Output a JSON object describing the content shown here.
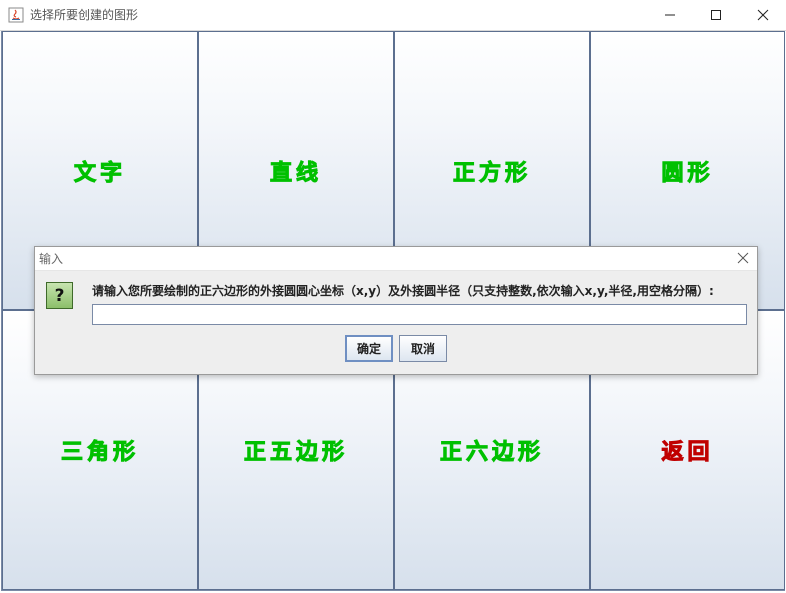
{
  "window": {
    "title": "选择所要创建的图形",
    "icons": [
      "java-app-icon",
      "minimize-icon",
      "maximize-icon",
      "close-icon"
    ]
  },
  "buttons": [
    {
      "label": "文字",
      "color": "#00ff00"
    },
    {
      "label": "直线",
      "color": "#00ff00"
    },
    {
      "label": "正方形",
      "color": "#00ff00"
    },
    {
      "label": "圆形",
      "color": "#00ff00"
    },
    {
      "label": "三角形",
      "color": "#00ff00"
    },
    {
      "label": "正五边形",
      "color": "#00ff00"
    },
    {
      "label": "正六边形",
      "color": "#00ff00"
    },
    {
      "label": "返回",
      "color": "#ee0000"
    }
  ],
  "dialog": {
    "title": "输入",
    "icon": "question-icon",
    "prompt": "请输入您所要绘制的正六边形的外接圆圆心坐标（x,y）及外接圆半径（只支持整数,依次输入x,y,半径,用空格分隔）:",
    "input_value": "",
    "ok_label": "确定",
    "cancel_label": "取消"
  }
}
